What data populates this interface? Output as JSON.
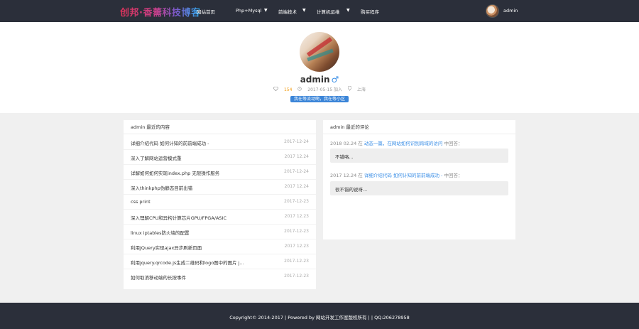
{
  "nav": {
    "logo": "创邦·香薷科技博客",
    "items": [
      {
        "label": "网站首页"
      },
      {
        "label": "Php+Mysql"
      },
      {
        "label": "前端技术"
      },
      {
        "label": "计算机运维"
      },
      {
        "label": "购买程序"
      }
    ],
    "caret": "▼",
    "user": "admin"
  },
  "profile": {
    "name": "admin",
    "gender_icon": "♂",
    "points_icon": "gem-icon",
    "points": "154",
    "joined": "2017-05-15 加入",
    "location": "上海",
    "signature": "我在等流动啊，我在等小区"
  },
  "recent_posts": {
    "heading": "admin 最近的内容",
    "items": [
      {
        "title": "详细介绍代码 如何计知的前前端成功 -",
        "date": "2017-12-24"
      },
      {
        "title": "深入了解网站运营模式重",
        "date": "2017 12.24"
      },
      {
        "title": "详解如何如何实现index.php 无限操作服务",
        "date": "2017-12-24"
      },
      {
        "title": "深入thinkphp伪静态目前出错",
        "date": "2017 12.24"
      },
      {
        "title": "css print",
        "date": "2017-12-23"
      },
      {
        "title": "深入理解CPU和异构计算芯片GPU/FPGA/ASIC",
        "date": "2017 12.23"
      },
      {
        "title": "linux iptables防火墙的配置",
        "date": "2017-12-23"
      },
      {
        "title": "利用JQuery实现ajax异步刷新页面",
        "date": "2017 12.23"
      },
      {
        "title": "利用jquery.qrcode.js生成二维码和logo图中的图片 j...",
        "date": "2017-12-23"
      },
      {
        "title": "如何取消移动端的长按事件",
        "date": "2017-12-23"
      }
    ]
  },
  "recent_comments": {
    "heading": "admin 最近的评论",
    "items": [
      {
        "date": "2018 02.24",
        "prefix": "在",
        "link": "动态一篇，在网站如何识别跨域的访问",
        "suffix": "中回答：",
        "text": "不错咯..."
      },
      {
        "date": "2017 12.24",
        "prefix": "在",
        "link": "详细介绍代码 如何计知的前前端成功 -",
        "suffix": "中回答：",
        "text": "很不错的说呀..."
      }
    ]
  },
  "footer": {
    "text": "Copyright© 2014-2017  |  Powered by 网站开发工作室版权所有  |   | QQ:206278958"
  },
  "colors": {
    "nav_bg": "#2b2f3a",
    "accent_blue": "#3a8ee6",
    "points_orange": "#f39c12"
  }
}
